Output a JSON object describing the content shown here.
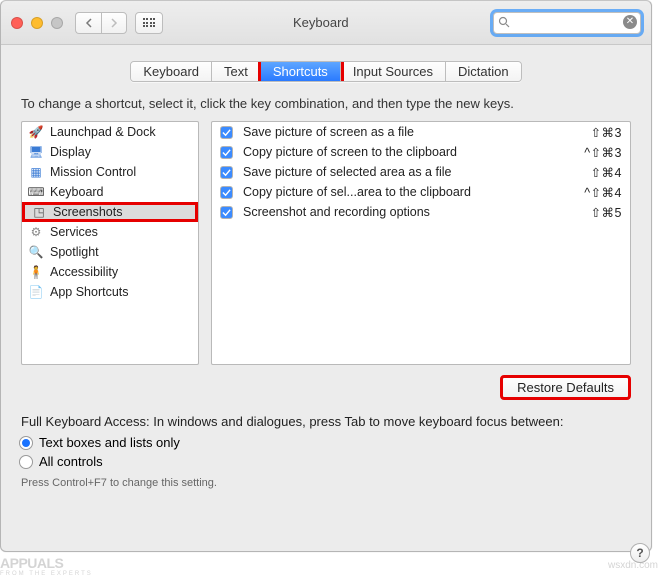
{
  "window": {
    "title": "Keyboard"
  },
  "search": {
    "placeholder": ""
  },
  "tabs": [
    "Keyboard",
    "Text",
    "Shortcuts",
    "Input Sources",
    "Dictation"
  ],
  "active_tab_index": 2,
  "instruction": "To change a shortcut, select it, click the key combination, and then type the new keys.",
  "categories": [
    {
      "icon": "launchpad-icon",
      "label": "Launchpad & Dock"
    },
    {
      "icon": "display-icon",
      "label": "Display"
    },
    {
      "icon": "mission-control-icon",
      "label": "Mission Control"
    },
    {
      "icon": "keyboard-icon",
      "label": "Keyboard"
    },
    {
      "icon": "screenshots-icon",
      "label": "Screenshots"
    },
    {
      "icon": "services-icon",
      "label": "Services"
    },
    {
      "icon": "spotlight-icon",
      "label": "Spotlight"
    },
    {
      "icon": "accessibility-icon",
      "label": "Accessibility"
    },
    {
      "icon": "app-shortcuts-icon",
      "label": "App Shortcuts"
    }
  ],
  "selected_category_index": 4,
  "shortcuts": [
    {
      "checked": true,
      "label": "Save picture of screen as a file",
      "keys": "⇧⌘3"
    },
    {
      "checked": true,
      "label": "Copy picture of screen to the clipboard",
      "keys": "^⇧⌘3"
    },
    {
      "checked": true,
      "label": "Save picture of selected area as a file",
      "keys": "⇧⌘4"
    },
    {
      "checked": true,
      "label": "Copy picture of sel...area to the clipboard",
      "keys": "^⇧⌘4"
    },
    {
      "checked": true,
      "label": "Screenshot and recording options",
      "keys": "⇧⌘5"
    }
  ],
  "restore_label": "Restore Defaults",
  "fka": {
    "label": "Full Keyboard Access: In windows and dialogues, press Tab to move keyboard focus between:",
    "options": [
      "Text boxes and lists only",
      "All controls"
    ],
    "selected": 0,
    "hint": "Press Control+F7 to change this setting."
  },
  "footer": {
    "left_brand": "APPUALS",
    "left_tag": "FROM THE EXPERTS",
    "right_credit": "wsxdn.com"
  }
}
